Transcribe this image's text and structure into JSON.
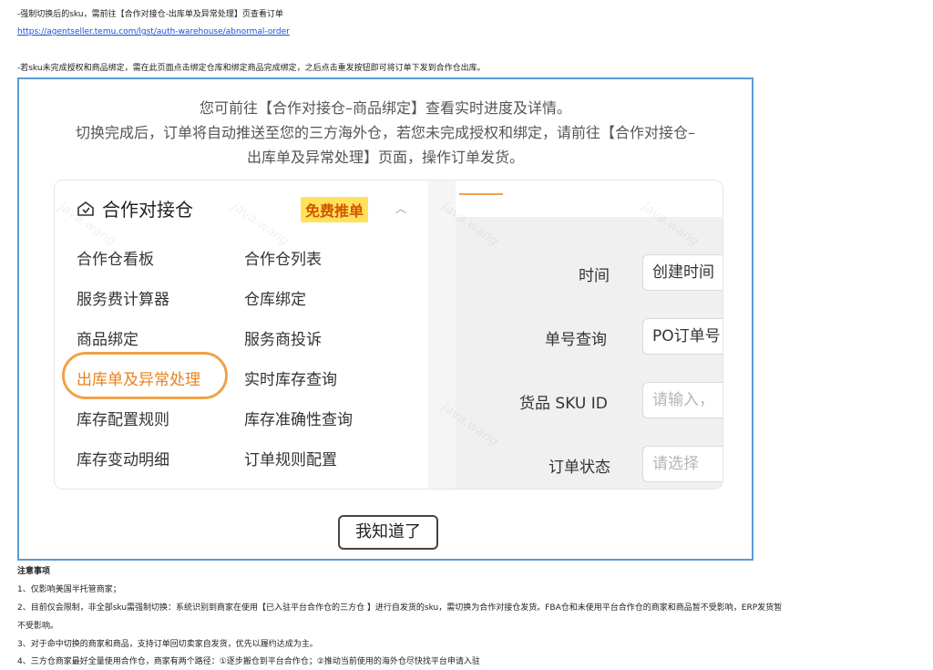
{
  "doc": {
    "line1": "-强制切换后的sku，需前往【合作对接仓-出库单及异常处理】页查看订单",
    "link": "https://agentseller.temu.com/lgst/auth-warehouse/abnormal-order",
    "line3": "-若sku未完成授权和商品绑定，需在此页面点击绑定仓库和绑定商品完成绑定，之后点击重发按钮即可将订单下发到合作仓出库。",
    "notes_title": "注意事项",
    "notes": [
      "1、仅影响美国半托管商家；",
      "2、目前仅会限制，非全部sku需强制切换：系统识别到商家在使用【已入驻平台合作仓的三方仓 】进行自发货的sku，需切换为合作对接仓发货。FBA仓和未使用平台合作仓的商家和商品暂不受影响，ERP发货暂",
      "不受影响。",
      "3、对于命中切换的商家和商品，支持订单回切卖家自发货，优先以履约达成为主。",
      "4、三方仓商家最好全量使用合作仓，商家有两个路径：①逐步搬仓到平台合作仓；②推动当前使用的海外仓尽快找平台申请入驻"
    ]
  },
  "dialog": {
    "intro": [
      "您可前往【合作对接仓–商品绑定】查看实时进度及详情。",
      "切换完成后，订单将自动推送至您的三方海外仓，若您未完成授权和绑定，请前往【合作对接仓–",
      "出库单及异常处理】页面，操作订单发货。"
    ],
    "menu_title": "合作对接仓",
    "menu_icon": "house-icon",
    "badge": "免费推单",
    "caret": "^",
    "menu_items": [
      "合作仓看板",
      "合作仓列表",
      "服务费计算器",
      "仓库绑定",
      "商品绑定",
      "服务商投诉",
      "出库单及异常处理",
      "实时库存查询",
      "库存配置规则",
      "库存准确性查询",
      "库存变动明细",
      "订单规则配置"
    ],
    "form": [
      {
        "label": "时间",
        "value": "创建时间"
      },
      {
        "label": "单号查询",
        "value": "PO订单号"
      },
      {
        "label": "货品 SKU ID",
        "placeholder": "请输入，"
      },
      {
        "label": "订单状态",
        "placeholder": "请选择"
      }
    ],
    "ok_button": "我知道了",
    "watermark": "java.wang",
    "highlight_color": "#f0a24a",
    "badge_color": "#ffe25a"
  }
}
